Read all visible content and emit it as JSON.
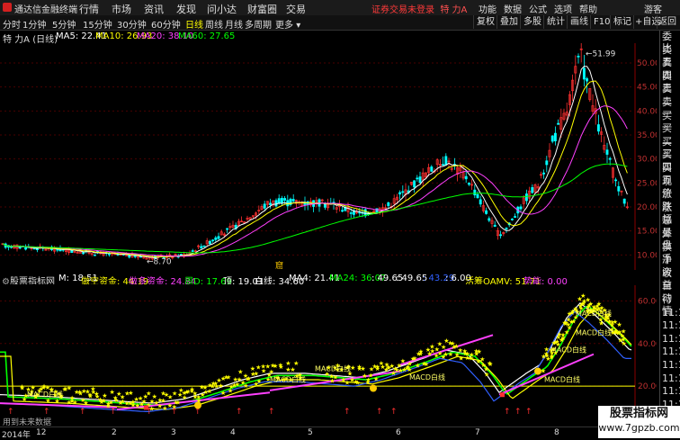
{
  "titlebar": {
    "app_name": "通达信金融终端",
    "menus": [
      "行情",
      "市场",
      "资讯",
      "发现",
      "问小达",
      "财富圈",
      "交易"
    ],
    "center_text": "证券交易未登录",
    "stock_title": "特 力A",
    "right_menus": [
      "功能",
      "数据",
      "公式",
      "选项",
      "帮助",
      "游客"
    ]
  },
  "toolbar": {
    "periods": [
      "分时",
      "1分钟",
      "5分钟",
      "15分钟",
      "30分钟",
      "60分钟",
      "日线",
      "周线",
      "月线",
      "多周期",
      "更多"
    ],
    "active_period": "日线",
    "tools": [
      "复权",
      "叠加",
      "多股",
      "统计",
      "画线",
      "F10",
      "标记",
      "+自选",
      "返回"
    ]
  },
  "ma_legend": {
    "name": "特 力A (日线)",
    "items": [
      {
        "label": "MA5: 22.41",
        "color": "#ffffff"
      },
      {
        "label": "MA10: 26.93",
        "color": "#ffff00"
      },
      {
        "label": "MA20: 38.10",
        "color": "#ff40ff"
      },
      {
        "label": "MA60: 27.65",
        "color": "#00ff00"
      }
    ]
  },
  "price_chart": {
    "y_ticks": [
      "50.00",
      "45.00",
      "40.00",
      "35.00",
      "30.00",
      "25.00",
      "20.00",
      "15.00",
      "10.00"
    ],
    "y_values": [
      50,
      45,
      40,
      35,
      30,
      25,
      20,
      15,
      10
    ],
    "high_label": "51.99",
    "low_label": "8.70",
    "flag_label": "窟"
  },
  "indicator": {
    "name": "股票指标网",
    "items": [
      {
        "label": "M: 18.51",
        "color": "#ffffff"
      },
      {
        "label": "做空资金: 44.19",
        "color": "#ffff00"
      },
      {
        "label": "做多资金: 24.84",
        "color": "#ff40ff"
      },
      {
        "label": "周D: 17.69",
        "color": "#00ff00"
      },
      {
        "label": "顶: 19.01",
        "color": "#ffffff"
      },
      {
        "label": "白线: 34.60",
        "color": "#ffffff"
      },
      {
        "label": "MA4: 21.41",
        "color": "#ffffff"
      },
      {
        "label": "MA24: 36.07",
        "color": "#00ff00"
      },
      {
        "label": ": 49.65",
        "color": "#ffffff"
      },
      {
        "label": ": 49.65",
        "color": "#ffffff"
      },
      {
        "label": ": 43.29",
        "color": "#3060ff"
      },
      {
        "label": ": 6.00",
        "color": "#ffffff"
      },
      {
        "label": "活筹OAMV: 51.71",
        "color": "#ffff00"
      },
      {
        "label": "势能: 0.00",
        "color": "#ff40ff"
      }
    ],
    "y_ticks": [
      "60.00",
      "40.00",
      "20.00"
    ],
    "y_values": [
      60,
      40,
      20
    ],
    "macd_label": "MACD白线",
    "datalink": "用到未来数据"
  },
  "right_panel": {
    "items": [
      "委比",
      "卖五",
      "卖四",
      "卖三",
      "卖二",
      "卖一",
      "买一",
      "买二",
      "买三",
      "买四",
      "买五",
      "现价",
      "涨跌",
      "涨幅",
      "总量",
      "外盘",
      "换手",
      "净资",
      "收益",
      "自动",
      "行情",
      "11:1",
      "11:1",
      "11:1",
      "11:1",
      "11:1",
      "11:1",
      "11:1",
      "11:1",
      "11:1"
    ]
  },
  "xaxis": {
    "labels": [
      "2014年",
      "12",
      "2",
      "3",
      "4",
      "5",
      "6",
      "7",
      "8",
      "9"
    ]
  },
  "watermark": {
    "line1": "股票指标网",
    "line2": "www.7gpzb.com"
  }
}
